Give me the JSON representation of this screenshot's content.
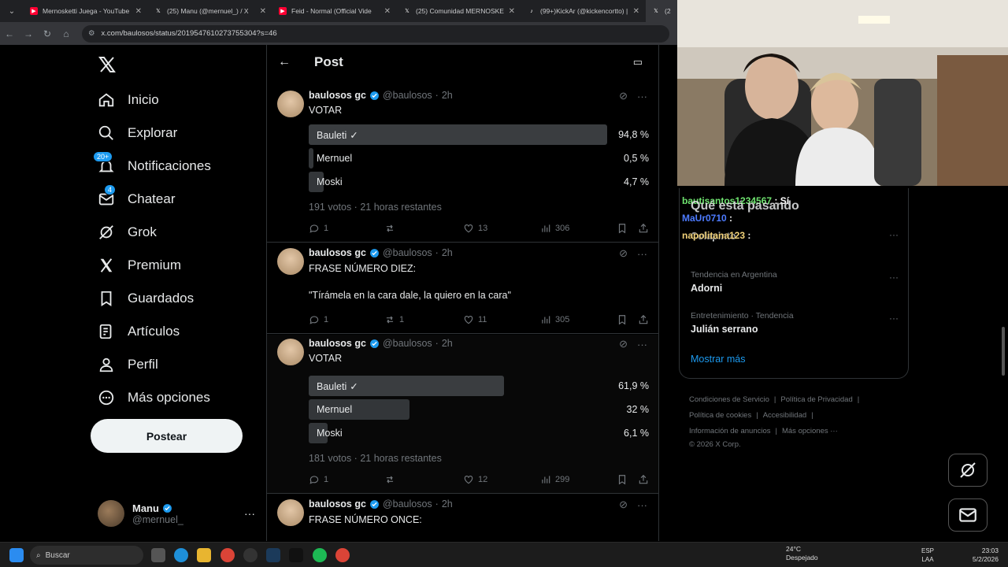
{
  "browser": {
    "tabs": [
      {
        "label": "Mernosketti Juega - YouTube",
        "icon": "youtube-icon",
        "color": "#ff0033"
      },
      {
        "label": "(25) Manu (@mernuel_) / X",
        "icon": "x-icon",
        "color": "#ffffff"
      },
      {
        "label": "Feid - Normal (Official Vide",
        "icon": "youtube-icon",
        "color": "#ff0033"
      },
      {
        "label": "(25) Comunidad MERNOSKETTI",
        "icon": "x-icon",
        "color": "#ffffff"
      },
      {
        "label": "(99+)KickAr (@kickencortto) | T",
        "icon": "tiktok-icon",
        "color": "#ffffff"
      },
      {
        "label": "(25) B",
        "icon": "x-icon",
        "color": "#ffffff"
      }
    ],
    "url": "x.com/baulosos/status/2019547610273755304?s=46"
  },
  "nav": {
    "items": [
      {
        "label": "Inicio",
        "icon": "home-icon"
      },
      {
        "label": "Explorar",
        "icon": "search-icon"
      },
      {
        "label": "Notificaciones",
        "icon": "bell-icon",
        "badge": "20+"
      },
      {
        "label": "Chatear",
        "icon": "mail-icon",
        "badge": "4"
      },
      {
        "label": "Grok",
        "icon": "grok-icon"
      },
      {
        "label": "Premium",
        "icon": "x-icon"
      },
      {
        "label": "Guardados",
        "icon": "bookmark-icon"
      },
      {
        "label": "Artículos",
        "icon": "article-icon"
      },
      {
        "label": "Perfil",
        "icon": "person-icon"
      },
      {
        "label": "Más opciones",
        "icon": "more-circle-icon"
      }
    ],
    "post_button": "Postear",
    "profile": {
      "name": "Manu",
      "handle": "@mernuel_"
    }
  },
  "timeline": {
    "title": "Post",
    "tweets": [
      {
        "name": "baulosos gc",
        "handle": "@baulosos",
        "time": "2h",
        "text": "VOTAR",
        "poll": [
          {
            "label": "Bauleti",
            "pct": "94,8 %",
            "fraction": 0.948,
            "winner": true
          },
          {
            "label": "Mernuel",
            "pct": "0,5 %",
            "fraction": 0.005
          },
          {
            "label": "Moski",
            "pct": "4,7 %",
            "fraction": 0.047
          }
        ],
        "poll_meta": "191 votos · 21 horas restantes",
        "replies": "1",
        "reposts": "",
        "likes": "13",
        "views": "306"
      },
      {
        "name": "baulosos gc",
        "handle": "@baulosos",
        "time": "2h",
        "text": "FRASE NÚMERO DIEZ:",
        "quote": "\"Tírámela en la cara dale, la quiero en la cara\"",
        "replies": "1",
        "reposts": "1",
        "likes": "11",
        "views": "305"
      },
      {
        "name": "baulosos gc",
        "handle": "@baulosos",
        "time": "2h",
        "text": "VOTAR",
        "poll": [
          {
            "label": "Bauleti",
            "pct": "61,9 %",
            "fraction": 0.619,
            "winner": true
          },
          {
            "label": "Mernuel",
            "pct": "32 %",
            "fraction": 0.32
          },
          {
            "label": "Moski",
            "pct": "6,1 %",
            "fraction": 0.061
          }
        ],
        "poll_meta": "181 votos · 21 horas restantes",
        "replies": "1",
        "reposts": "",
        "likes": "12",
        "views": "299"
      },
      {
        "name": "baulosos gc",
        "handle": "@baulosos",
        "time": "2h",
        "text": "FRASE NÚMERO ONCE:"
      }
    ]
  },
  "right": {
    "heading": "Qué está pasando",
    "trends": [
      {
        "category": "",
        "title": "Colapinto"
      },
      {
        "category": "Tendencia en Argentina",
        "title": "Adorni"
      },
      {
        "category": "Entretenimiento · Tendencia",
        "title": "Julián serrano"
      }
    ],
    "show_more": "Mostrar más",
    "footer": [
      "Condiciones de Servicio",
      "Política de Privacidad",
      "Política de cookies",
      "Accesibilidad",
      "Información de anuncios",
      "Más opciones ···",
      "© 2026 X Corp."
    ]
  },
  "chat": [
    {
      "user": "bautisantos1234567",
      "msg": ": Sí",
      "color": "#6fe36f"
    },
    {
      "user": "MaUr0710",
      "msg": ":",
      "color": "#4d7bff"
    },
    {
      "user": "napolitana123",
      "msg": ":",
      "color": "#f2d27a"
    }
  ],
  "taskbar": {
    "search": "Buscar",
    "weather_temp": "24°C",
    "weather_desc": "Despejado",
    "lang_top": "ESP",
    "lang_bottom": "LAA",
    "time": "23:03",
    "date": "5/2/2026"
  }
}
